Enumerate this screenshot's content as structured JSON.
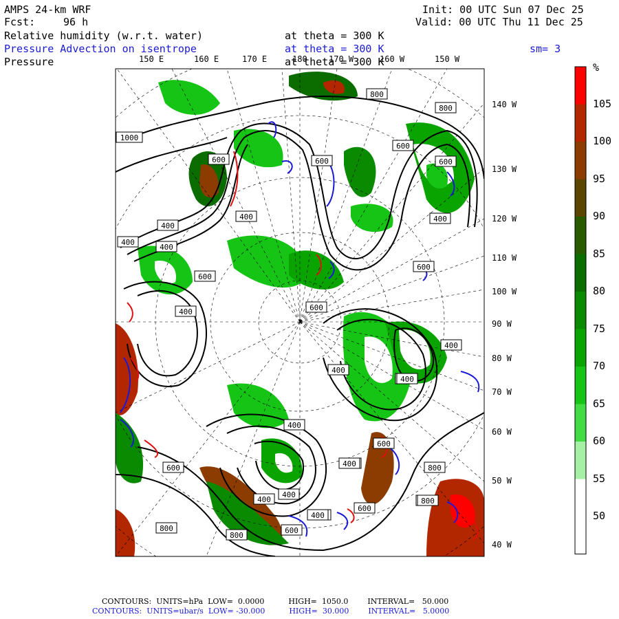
{
  "header": {
    "model": "AMPS 24-km WRF",
    "fcst_label": "Fcst:",
    "fcst_value": "96 h",
    "init": "Init: 00 UTC Sun 07 Dec 25",
    "valid": "Valid: 00 UTC Thu 11 Dec 25",
    "field1_name": "Relative humidity (w.r.t. water)",
    "field1_level": "at theta = 300 K",
    "field2_name": "Pressure Advection on isentrope",
    "field2_level": "at theta = 300 K",
    "field2_smooth": "sm= 3",
    "field3_name": "Pressure",
    "field3_level": "at theta = 300 K"
  },
  "longitude_labels_top": [
    "150 E",
    "160 E",
    "170 E",
    "180",
    "170 W",
    "160 W",
    "150 W"
  ],
  "longitude_labels_right": [
    "140 W",
    "130 W",
    "120 W",
    "110 W",
    "100 W",
    "90 W",
    "80 W",
    "70 W",
    "60 W",
    "50 W",
    "40 W"
  ],
  "contour_labels": [
    "800",
    "800",
    "600",
    "600",
    "600",
    "600",
    "400",
    "400",
    "400",
    "400",
    "400",
    "1000",
    "600",
    "600",
    "400",
    "400",
    "400",
    "600",
    "800",
    "800",
    "600",
    "400",
    "400",
    "600",
    "400",
    "400",
    "800",
    "600",
    "800",
    "400",
    "600",
    "800",
    "600",
    "400",
    "400",
    "600"
  ],
  "colorbar": {
    "unit": "%",
    "levels": [
      "105",
      "100",
      "95",
      "90",
      "85",
      "80",
      "75",
      "70",
      "65",
      "60",
      "55",
      "50"
    ],
    "colors": [
      "#ff0000",
      "#b22600",
      "#8c3c00",
      "#5a4600",
      "#2a5a00",
      "#0b6c00",
      "#0a8a00",
      "#0aa400",
      "#16c416",
      "#44dc44",
      "#a6f0a6",
      "#ffffff",
      "#ffffff"
    ]
  },
  "footer": {
    "line1": "CONTOURS:  UNITS=hPa  LOW=  0.0000          HIGH=  1050.0        INTERVAL=   50.000",
    "line2": "CONTOURS:  UNITS=ubar/s  LOW= -30.000          HIGH=  30.000        INTERVAL=   5.0000"
  }
}
